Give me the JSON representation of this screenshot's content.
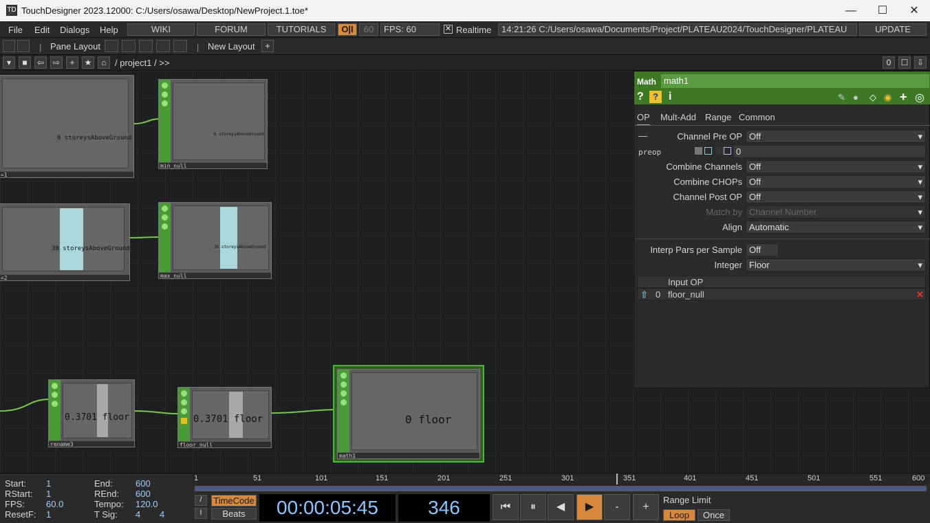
{
  "window": {
    "title": "TouchDesigner 2023.12000: C:/Users/osawa/Desktop/NewProject.1.toe*",
    "app_icon_glyph": "TD",
    "minimize_glyph": "—",
    "maximize_glyph": "☐",
    "close_glyph": "✕"
  },
  "menubar": {
    "menus": [
      "File",
      "Edit",
      "Dialogs",
      "Help"
    ],
    "links": [
      "WIKI",
      "FORUM",
      "TUTORIALS"
    ],
    "oi_label": "O|I",
    "fps_cap": "60",
    "fps_label": "FPS:  60",
    "realtime_check": "✕",
    "realtime_label": "Realtime",
    "status": "14:21:26 C:/Users/osawa/Documents/Project/PLATEAU2024/TouchDesigner/PLATEAU",
    "update_label": "UPDATE"
  },
  "layoutbar": {
    "pane_layout": "Pane Layout",
    "new_layout": "New Layout",
    "add_glyph": "+"
  },
  "pathbar": {
    "path": "/ project1 / >>",
    "counter": "0",
    "buttons": [
      "▾",
      "■",
      "⇦",
      "⇨",
      "+",
      "★",
      "⌂"
    ],
    "right_buttons": [
      "☐",
      "⇩"
    ]
  },
  "network": {
    "nodes": [
      {
        "id": "top-left-a",
        "label": "=1",
        "value_text": "0 storeysAboveGround"
      },
      {
        "id": "min-null",
        "label": "min_null",
        "value_text": "0 storeysAboveGround"
      },
      {
        "id": "top-left-b",
        "label": "=2",
        "value_text": "38 storeysAboveGround"
      },
      {
        "id": "max-null",
        "label": "max_null",
        "value_text": "36 storeysAboveGround"
      },
      {
        "id": "rename3",
        "label": "rename3",
        "value_text": "0.3701 floor"
      },
      {
        "id": "floor-null",
        "label": "floor_null",
        "value_text": "0.3701 floor"
      },
      {
        "id": "math1",
        "label": "math1",
        "value_text": "0 floor"
      }
    ]
  },
  "panel": {
    "op_type": "Math",
    "op_name": "math1",
    "header_icons": [
      "?",
      "?",
      "i"
    ],
    "tool_icons": [
      "✎",
      "●",
      "◇",
      "◉",
      "+",
      "◎"
    ],
    "tabs": [
      "OP",
      "Mult-Add",
      "Range",
      "Common"
    ],
    "collapse_glyph": "—",
    "params": [
      {
        "label": "Channel Pre OP",
        "value": "Off"
      },
      {
        "label": "Combine Channels",
        "value": "Off"
      },
      {
        "label": "Combine CHOPs",
        "value": "Off"
      },
      {
        "label": "Channel Post OP",
        "value": "Off"
      },
      {
        "label": "Match by",
        "value": "Channel Number"
      },
      {
        "label": "Align",
        "value": "Automatic"
      },
      {
        "label": "Interp Pars per Sample",
        "value": "Off"
      },
      {
        "label": "Integer",
        "value": "Floor"
      }
    ],
    "preop_label": "preop",
    "preop_value": "0",
    "input_header": "Input OP",
    "input_row": {
      "index": "0",
      "value": "floor_null",
      "remove": "✕",
      "drag": "⇧"
    }
  },
  "timebar": {
    "start_label": "Start:",
    "start": "1",
    "end_label": "End:",
    "end": "600",
    "rstart_label": "RStart:",
    "rstart": "1",
    "rend_label": "REnd:",
    "rend": "600",
    "fps_label": "FPS:",
    "fps": "60.0",
    "tempo_label": "Tempo:",
    "tempo": "120.0",
    "resetf_label": "ResetF:",
    "resetf": "1",
    "tsig_label": "T Sig:",
    "tsig_a": "4",
    "tsig_b": "4",
    "ruler": [
      "1",
      "51",
      "101",
      "151",
      "201",
      "251",
      "301",
      "351",
      "401",
      "451",
      "501",
      "551",
      "600"
    ],
    "timecode_label": "TimeCode",
    "beats_label": "Beats",
    "timecode": "00:00:05:45",
    "frame": "346",
    "transport": [
      "⏮",
      "⏸",
      "◀",
      "▶",
      "-",
      "+"
    ],
    "range_limit": "Range Limit",
    "loop": "Loop",
    "once": "Once",
    "side_glyphs": [
      "/",
      "I"
    ]
  },
  "colors": {
    "accent_green": "#3e7a26",
    "wire": "#7bc84a",
    "orange": "#d8883a",
    "timecode": "#8cc4ff"
  }
}
